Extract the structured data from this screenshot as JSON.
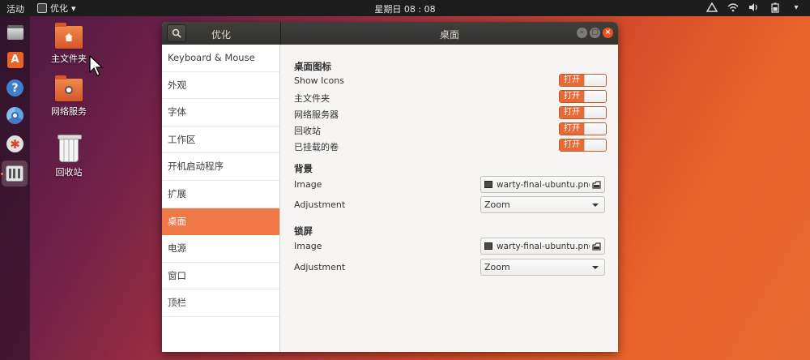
{
  "topbar": {
    "activities": "活动",
    "app_menu": "优化",
    "clock": "星期日 08 : 08"
  },
  "desktop": {
    "icons": [
      {
        "label": "主文件夹"
      },
      {
        "label": "网络服务"
      },
      {
        "label": "回收站"
      }
    ]
  },
  "window": {
    "left_title": "优化",
    "title": "桌面",
    "sidebar": [
      "Keyboard & Mouse",
      "外观",
      "字体",
      "工作区",
      "开机启动程序",
      "扩展",
      "桌面",
      "电源",
      "窗口",
      "顶栏"
    ],
    "active_item": "桌面",
    "desktop_icons_section": {
      "title": "桌面图标",
      "rows": [
        {
          "label": "Show Icons",
          "state": "打开"
        },
        {
          "label": "主文件夹",
          "state": "打开"
        },
        {
          "label": "网络服务器",
          "state": "打开"
        },
        {
          "label": "回收站",
          "state": "打开"
        },
        {
          "label": "已挂载的卷",
          "state": "打开"
        }
      ]
    },
    "background_section": {
      "title": "背景",
      "image_label": "Image",
      "image_value": "warty-final-ubuntu.png",
      "adjustment_label": "Adjustment",
      "adjustment_value": "Zoom"
    },
    "lockscreen_section": {
      "title": "锁屏",
      "image_label": "Image",
      "image_value": "warty-final-ubuntu.png",
      "adjustment_label": "Adjustment",
      "adjustment_value": "Zoom"
    }
  },
  "colors": {
    "accent": "#e95420",
    "selected": "#f07746",
    "toggle_on": "#e86a36",
    "topbar": "#1d1d1d"
  }
}
